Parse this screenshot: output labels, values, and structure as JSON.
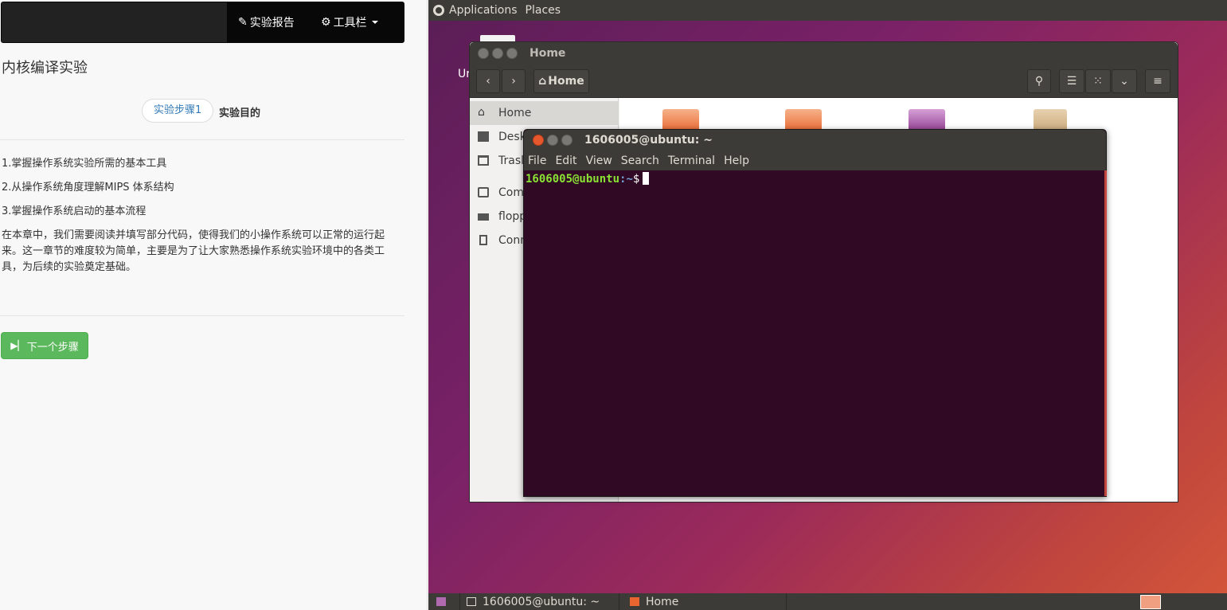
{
  "left_panel": {
    "nav": {
      "report_label": "实验报告",
      "tools_label": "工具栏"
    },
    "lab_title": "内核编译实验",
    "step_pill": "实验步骤1",
    "step_title": "实验目的",
    "goals": [
      "1.掌握操作系统实验所需的基本工具",
      "2.从操作系统角度理解MIPS 体系结构",
      "3.掌握操作系统启动的基本流程"
    ],
    "description": "在本章中，我们需要阅读并填写部分代码，使得我们的小操作系统可以正常的运行起来。这一章节的难度较为简单，主要是为了让大家熟悉操作系统实验环境中的各类工具，为后续的实验奠定基础。",
    "next_button": "下一个步骤"
  },
  "desktop": {
    "top_panel": {
      "applications": "Applications",
      "places": "Places"
    },
    "desktop_icon_label": "Ur",
    "file_manager": {
      "title": "Home",
      "location": "Home",
      "sidebar": [
        "Home",
        "Desk",
        "Trasl",
        "Com",
        "flopp",
        "Conn"
      ]
    },
    "terminal": {
      "title": "1606005@ubuntu: ~",
      "menu": [
        "File",
        "Edit",
        "View",
        "Search",
        "Terminal",
        "Help"
      ],
      "prompt_user": "1606005@ubuntu",
      "prompt_path": ":~",
      "prompt_symbol": "$"
    },
    "taskbar": {
      "terminal_task": "1606005@ubuntu: ~",
      "home_task": "Home"
    }
  },
  "colors": {
    "nav_bg": "#222222",
    "next_button": "#5cb85c",
    "terminal_bg": "#300a24",
    "prompt_user": "#8ae234",
    "prompt_path": "#729fcf",
    "ubuntu_panel": "#3c3b37"
  }
}
